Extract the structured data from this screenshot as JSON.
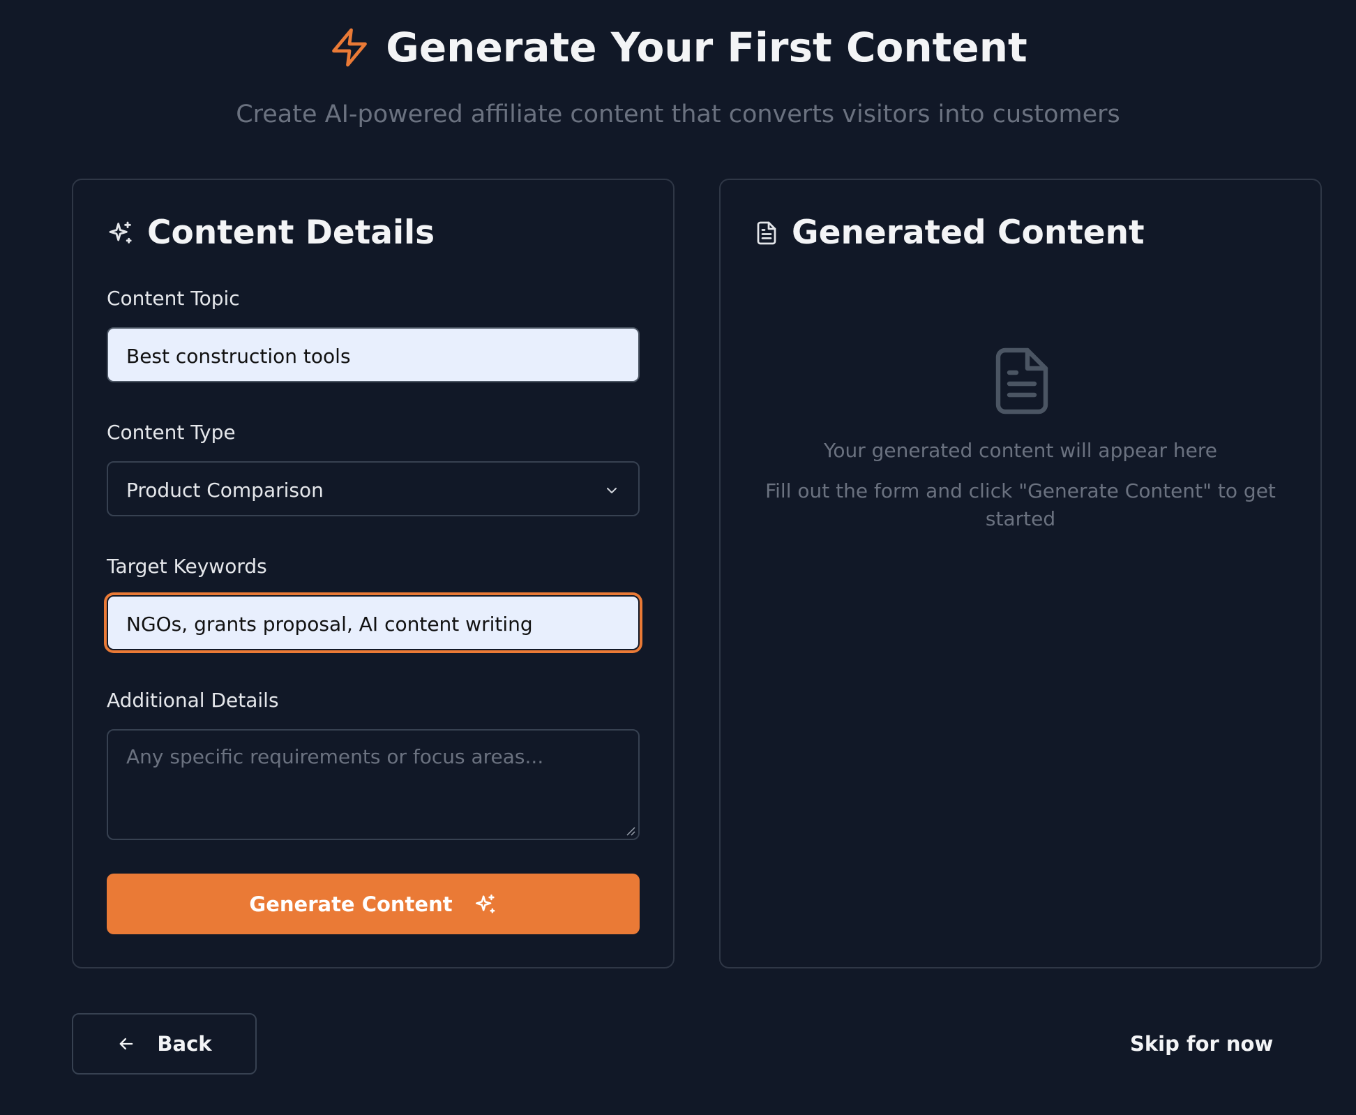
{
  "header": {
    "title": "Generate Your First Content",
    "subtitle": "Create AI-powered affiliate content that converts visitors into customers",
    "icon": "lightning-bolt-icon"
  },
  "colors": {
    "background": "#111827",
    "accent": "#ea7a36",
    "card_border": "#2f3746",
    "input_fill": "#e8effd",
    "muted_text": "#6b7280"
  },
  "form": {
    "title": "Content Details",
    "title_icon": "sparkles-icon",
    "topic": {
      "label": "Content Topic",
      "value": "Best construction tools"
    },
    "content_type": {
      "label": "Content Type",
      "selected": "Product Comparison",
      "icon": "chevron-down-icon"
    },
    "keywords": {
      "label": "Target Keywords",
      "value": "NGOs, grants proposal, AI content writing",
      "focused": true
    },
    "details": {
      "label": "Additional Details",
      "placeholder": "Any specific requirements or focus areas..."
    },
    "submit_label": "Generate Content"
  },
  "output": {
    "title": "Generated Content",
    "title_icon": "document-icon",
    "empty_title": "Your generated content will appear here",
    "empty_hint": "Fill out the form and click \"Generate Content\" to get started"
  },
  "footer": {
    "back_label": "Back",
    "skip_label": "Skip for now"
  }
}
